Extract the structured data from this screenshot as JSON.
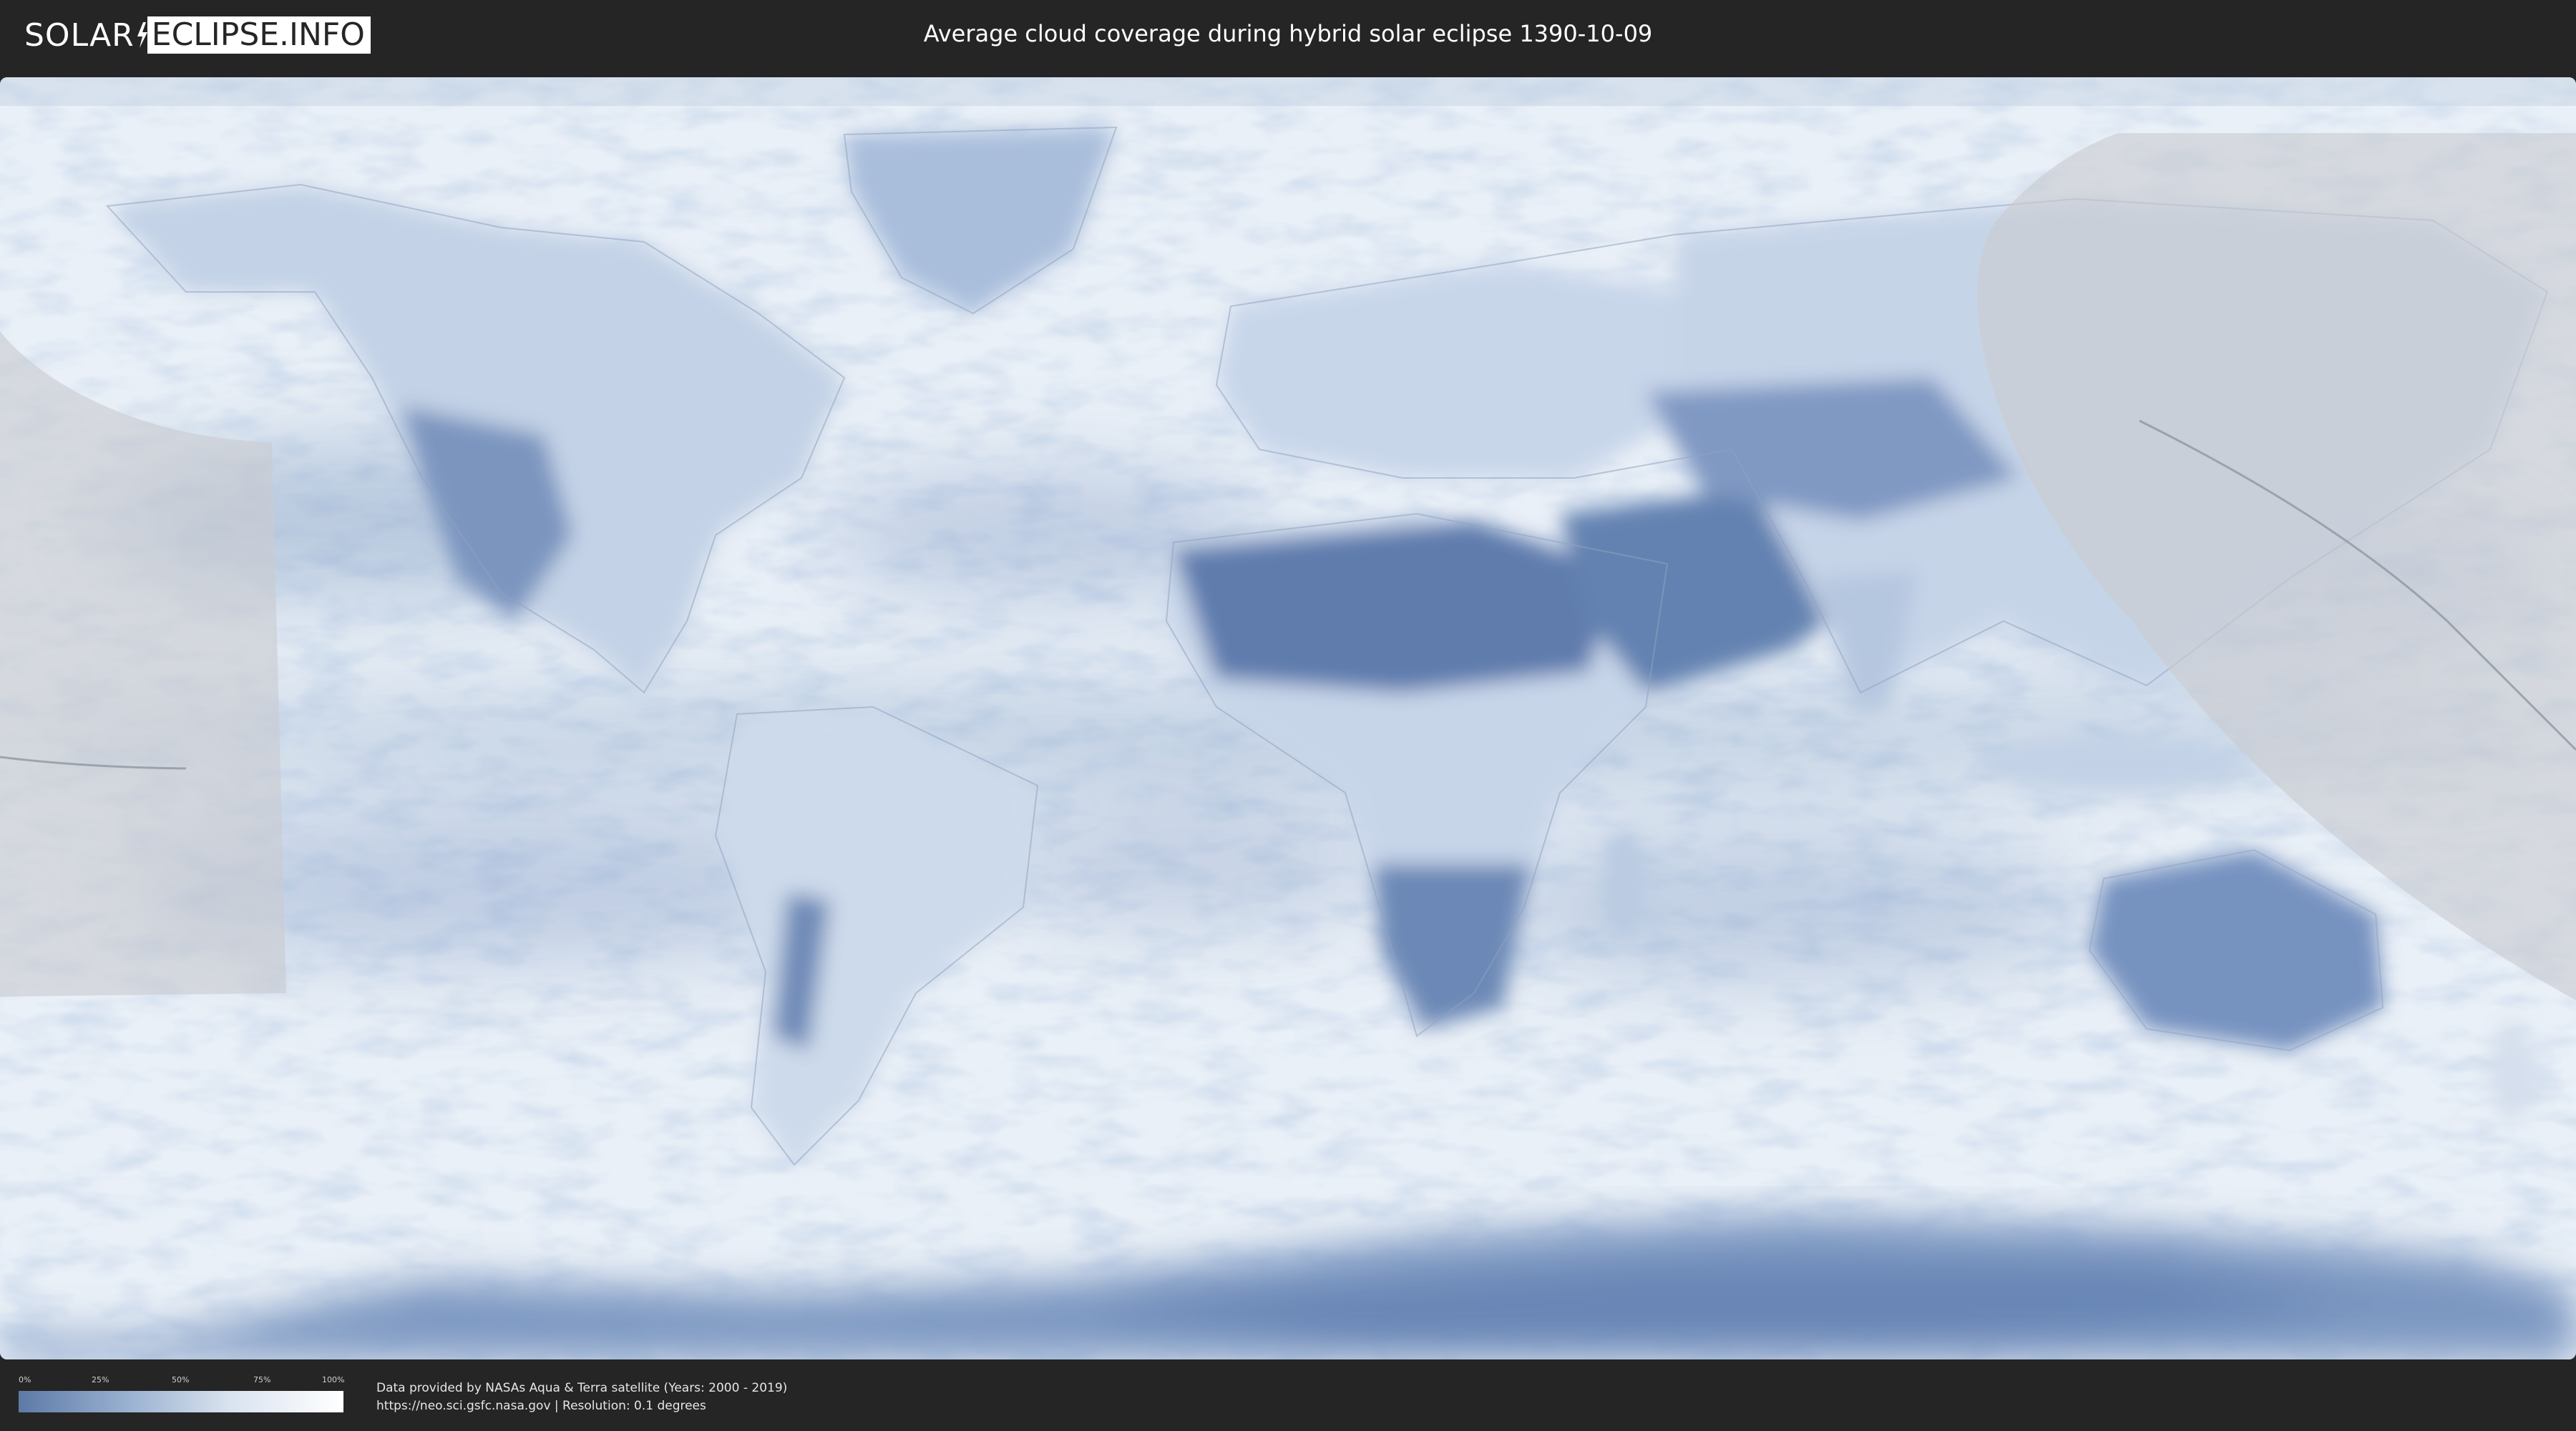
{
  "header": {
    "logo_left": "SOLAR",
    "logo_right": "ECLIPSE.INFO",
    "title": "Average cloud coverage during hybrid solar eclipse 1390-10-09"
  },
  "map": {
    "ocean_color": "#eef3f8",
    "dry_land_color": "#6a86b3",
    "eclipse_shadow_color": "#c9ccd0",
    "path_line_color": "#8a949e"
  },
  "legend": {
    "ticks": [
      "0%",
      "25%",
      "50%",
      "75%",
      "100%"
    ],
    "gradient_start": "#5d7aa7",
    "gradient_end": "#ffffff"
  },
  "footer": {
    "credit_line1": "Data provided by NASAs Aqua & Terra satellite (Years: 2000 - 2019)",
    "credit_line2": "https://neo.sci.gsfc.nasa.gov | Resolution: 0.1 degrees"
  }
}
